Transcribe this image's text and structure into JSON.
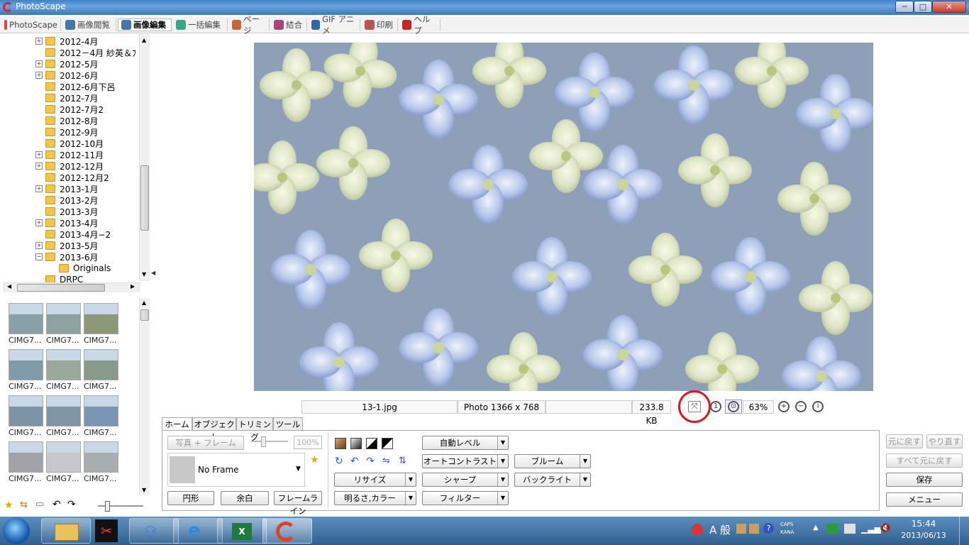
{
  "window": {
    "title": "PhotoScape"
  },
  "window_buttons": {
    "minimize": "─",
    "maximize": "□",
    "close": "✕"
  },
  "menu_tabs": [
    {
      "label": "PhotoScape",
      "icon": "photoscape-icon",
      "color": "#d44"
    },
    {
      "label": "画像閲覧",
      "icon": "viewer-icon",
      "color": "#47a"
    },
    {
      "label": "画像編集",
      "icon": "editor-icon",
      "color": "#47a",
      "active": true
    },
    {
      "label": "一括編集",
      "icon": "batch-icon",
      "color": "#3a8"
    },
    {
      "label": "ページ",
      "icon": "page-icon",
      "color": "#c63"
    },
    {
      "label": "結合",
      "icon": "combine-icon",
      "color": "#a47"
    },
    {
      "label": "GIF アニメ",
      "icon": "gif-icon",
      "color": "#36a"
    },
    {
      "label": "印刷",
      "icon": "print-icon",
      "color": "#b55"
    },
    {
      "label": "ヘルプ",
      "icon": "help-icon",
      "color": "#c22"
    }
  ],
  "tree": [
    {
      "label": "2012-4月",
      "expander": "+"
    },
    {
      "label": "2012－4月  紗英＆ﾌ",
      "expander": ""
    },
    {
      "label": "2012-5月",
      "expander": "+"
    },
    {
      "label": "2012-6月",
      "expander": "+"
    },
    {
      "label": "2012-6月下呂",
      "expander": ""
    },
    {
      "label": "2012-7月",
      "expander": ""
    },
    {
      "label": "2012-7月2",
      "expander": ""
    },
    {
      "label": "2012-8月",
      "expander": ""
    },
    {
      "label": "2012-9月",
      "expander": ""
    },
    {
      "label": "2012-10月",
      "expander": ""
    },
    {
      "label": "2012-11月",
      "expander": "+"
    },
    {
      "label": "2012-12月",
      "expander": "+"
    },
    {
      "label": "2012-12月2",
      "expander": ""
    },
    {
      "label": "2013-1月",
      "expander": "+"
    },
    {
      "label": "2013-2月",
      "expander": ""
    },
    {
      "label": "2013-3月",
      "expander": ""
    },
    {
      "label": "2013-4月",
      "expander": "+"
    },
    {
      "label": "2013-4月−2",
      "expander": ""
    },
    {
      "label": "2013-5月",
      "expander": "+"
    },
    {
      "label": "2013-6月",
      "expander": "−"
    },
    {
      "label": "Originals",
      "expander": "",
      "child": true
    },
    {
      "label": "DRPC",
      "expander": ""
    }
  ],
  "thumbnails": [
    {
      "caption": "CIMG7...",
      "tone": "#8aa0a8"
    },
    {
      "caption": "CIMG7...",
      "tone": "#8ca2a0"
    },
    {
      "caption": "CIMG7...",
      "tone": "#8a9a78"
    },
    {
      "caption": "CIMG7...",
      "tone": "#7f9aa8"
    },
    {
      "caption": "CIMG7...",
      "tone": "#9aa89a"
    },
    {
      "caption": "CIMG7...",
      "tone": "#8a9a8a"
    },
    {
      "caption": "CIMG7...",
      "tone": "#7d93a8"
    },
    {
      "caption": "CIMG7...",
      "tone": "#8095a5"
    },
    {
      "caption": "CIMG7...",
      "tone": "#7b96b5"
    },
    {
      "caption": "CIMG7...",
      "tone": "#a0a4a8"
    },
    {
      "caption": "CIMG7...",
      "tone": "#c5c8c8"
    },
    {
      "caption": "CIMG7...",
      "tone": "#a8aeb0"
    }
  ],
  "status": {
    "filename": "13-1.jpg",
    "dimensions": "Photo 1366 x 768",
    "filesize": "233.8 KB",
    "zoom": "63%"
  },
  "panel_tabs": [
    "ホーム",
    "オブジェクト",
    "トリミング",
    "ツール"
  ],
  "frame": {
    "photo_frame_button": "写真 + フレーム",
    "zoom_percent": "100%",
    "selected_frame": "No Frame"
  },
  "shape_buttons": {
    "circle": "円形",
    "margin": "余白",
    "frame_line": "フレームライン"
  },
  "adjust_buttons": {
    "resize": "リサイズ",
    "brightness": "明るさ,カラー",
    "auto_level": "自動レベル",
    "auto_contrast": "オートコントラスト",
    "sharpen": "シャープ",
    "filter": "フィルター",
    "bloom": "ブルーム",
    "backlight": "バックライト"
  },
  "history": {
    "undo": "元に戻す",
    "redo": "やり直す",
    "undo_all": "すべて元に戻す",
    "save": "保存",
    "menu": "メニュー"
  },
  "taskbar": {
    "ime_mode": "A 般",
    "caps": "CAPS",
    "kana": "KANA",
    "time": "15:44",
    "date": "2013/06/13"
  }
}
